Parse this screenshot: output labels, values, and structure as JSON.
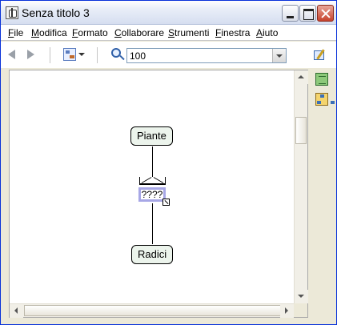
{
  "window": {
    "title": "Senza titolo 3"
  },
  "menubar": {
    "items": [
      "File",
      "Modifica",
      "Formato",
      "Collaborare",
      "Strumenti",
      "Finestra",
      "Aiuto"
    ]
  },
  "toolbar": {
    "zoom_value": "100"
  },
  "concept_map": {
    "concepts": [
      "Piante",
      "Radici"
    ],
    "link_phrase": "????"
  },
  "colors": {
    "title_bar": "#d6def0",
    "concept_fill": "#ecf4ec",
    "selection": "#a7a7e6"
  },
  "icons": {
    "app": "concept-map-app-icon",
    "back": "back-arrow-icon",
    "forward": "forward-arrow-icon",
    "view": "view-mode-icon",
    "zoom": "zoom-icon",
    "edit": "edit-styles-icon",
    "side_panel": [
      "book-icon",
      "network-icon"
    ]
  }
}
